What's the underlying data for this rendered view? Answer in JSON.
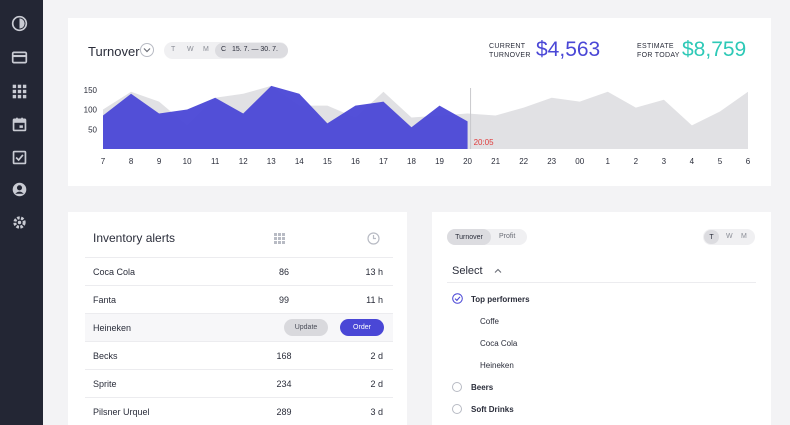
{
  "sidebar": {
    "items": [
      {
        "icon": "dashboard-gauge-icon"
      },
      {
        "icon": "credit-card-icon"
      },
      {
        "icon": "grid-apps-icon"
      },
      {
        "icon": "calendar-icon"
      },
      {
        "icon": "checkbox-icon"
      },
      {
        "icon": "user-icon"
      },
      {
        "icon": "settings-gear-icon"
      }
    ]
  },
  "turnover": {
    "title": "Turnover",
    "periods": [
      "T",
      "W",
      "M"
    ],
    "active_period": "C",
    "date_range": "15. 7. — 30. 7.",
    "current_label": "CURRENT TURNOVER",
    "current_value": "$4,563",
    "estimate_label": "ESTIMATE FOR TODAY",
    "estimate_value": "$8,759",
    "now_label": "20:05",
    "colors": {
      "actual": "#4a47d6",
      "estimate": "#e1e1e4",
      "current": "#4a47d6",
      "estimate_text": "#2ec9b7",
      "now": "#e03b3b"
    }
  },
  "chart_data": {
    "type": "area",
    "x": [
      "7",
      "8",
      "9",
      "10",
      "11",
      "12",
      "13",
      "14",
      "15",
      "16",
      "17",
      "18",
      "19",
      "20",
      "21",
      "22",
      "23",
      "00",
      "1",
      "2",
      "3",
      "4",
      "5",
      "6"
    ],
    "y_ticks": [
      "150",
      "100",
      "50"
    ],
    "ylim": [
      0,
      180
    ],
    "series": [
      {
        "values": [
          85,
          140,
          90,
          100,
          130,
          90,
          160,
          140,
          65,
          110,
          120,
          55,
          110,
          70
        ]
      },
      {
        "values": [
          100,
          145,
          120,
          60,
          130,
          140,
          160,
          110,
          110,
          80,
          145,
          80,
          85,
          90,
          85,
          105,
          130,
          120,
          145,
          105,
          125,
          60,
          95,
          145
        ]
      }
    ]
  },
  "inventory": {
    "title": "Inventory alerts",
    "rows": [
      {
        "name": "Coca Cola",
        "qty": "86",
        "time": "13 h"
      },
      {
        "name": "Fanta",
        "qty": "99",
        "time": "11 h"
      },
      {
        "name": "Heineken",
        "update": "Update",
        "order": "Order"
      },
      {
        "name": "Becks",
        "qty": "168",
        "time": "2 d"
      },
      {
        "name": "Sprite",
        "qty": "234",
        "time": "2 d"
      },
      {
        "name": "Pilsner Urquel",
        "qty": "289",
        "time": "3 d"
      }
    ]
  },
  "performers": {
    "tabs": {
      "active": "Turnover",
      "other": "Profit"
    },
    "periods": {
      "active": "T",
      "others": [
        "W",
        "M"
      ]
    },
    "select_label": "Select",
    "groups": {
      "top": "Top performers",
      "top_items": [
        "Coffe",
        "Coca Cola",
        "Heineken"
      ],
      "beers": "Beers",
      "soft": "Soft Drinks"
    }
  }
}
